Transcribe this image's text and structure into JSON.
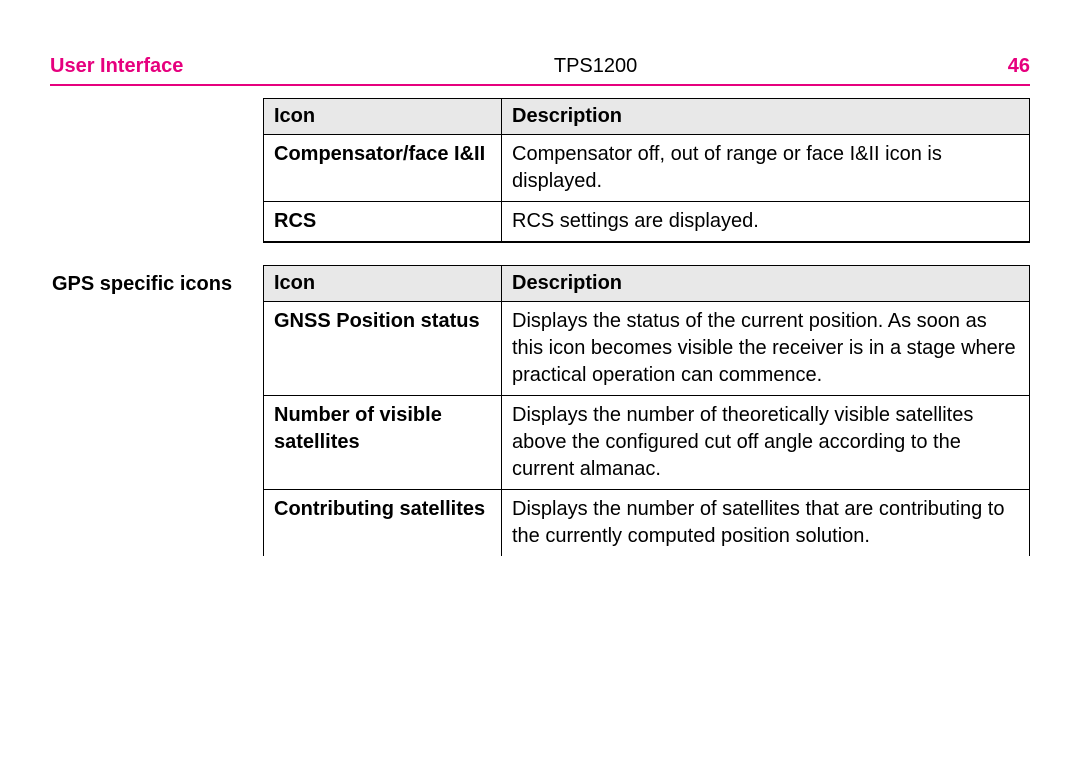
{
  "header": {
    "section": "User Interface",
    "model": "TPS1200",
    "page": "46"
  },
  "table1": {
    "headers": {
      "icon": "Icon",
      "description": "Description"
    },
    "rows": [
      {
        "icon": "Compensator/face I&II",
        "description": "Compensator off, out of range or face I&II icon is displayed."
      },
      {
        "icon": "RCS",
        "description": "RCS settings are displayed."
      }
    ]
  },
  "section2_label": "GPS specific icons",
  "table2": {
    "headers": {
      "icon": "Icon",
      "description": "Description"
    },
    "rows": [
      {
        "icon": "GNSS Position status",
        "description": "Displays the status of the current position. As soon as this icon becomes visible the receiver is in a stage where practical operation can commence."
      },
      {
        "icon": "Number of visible satellites",
        "description": "Displays the number of theoretically visible satellites above the configured cut off angle according to the current almanac."
      },
      {
        "icon": "Contributing satellites",
        "description": "Displays the number of satellites that are contributing to the currently computed position solution."
      }
    ]
  }
}
